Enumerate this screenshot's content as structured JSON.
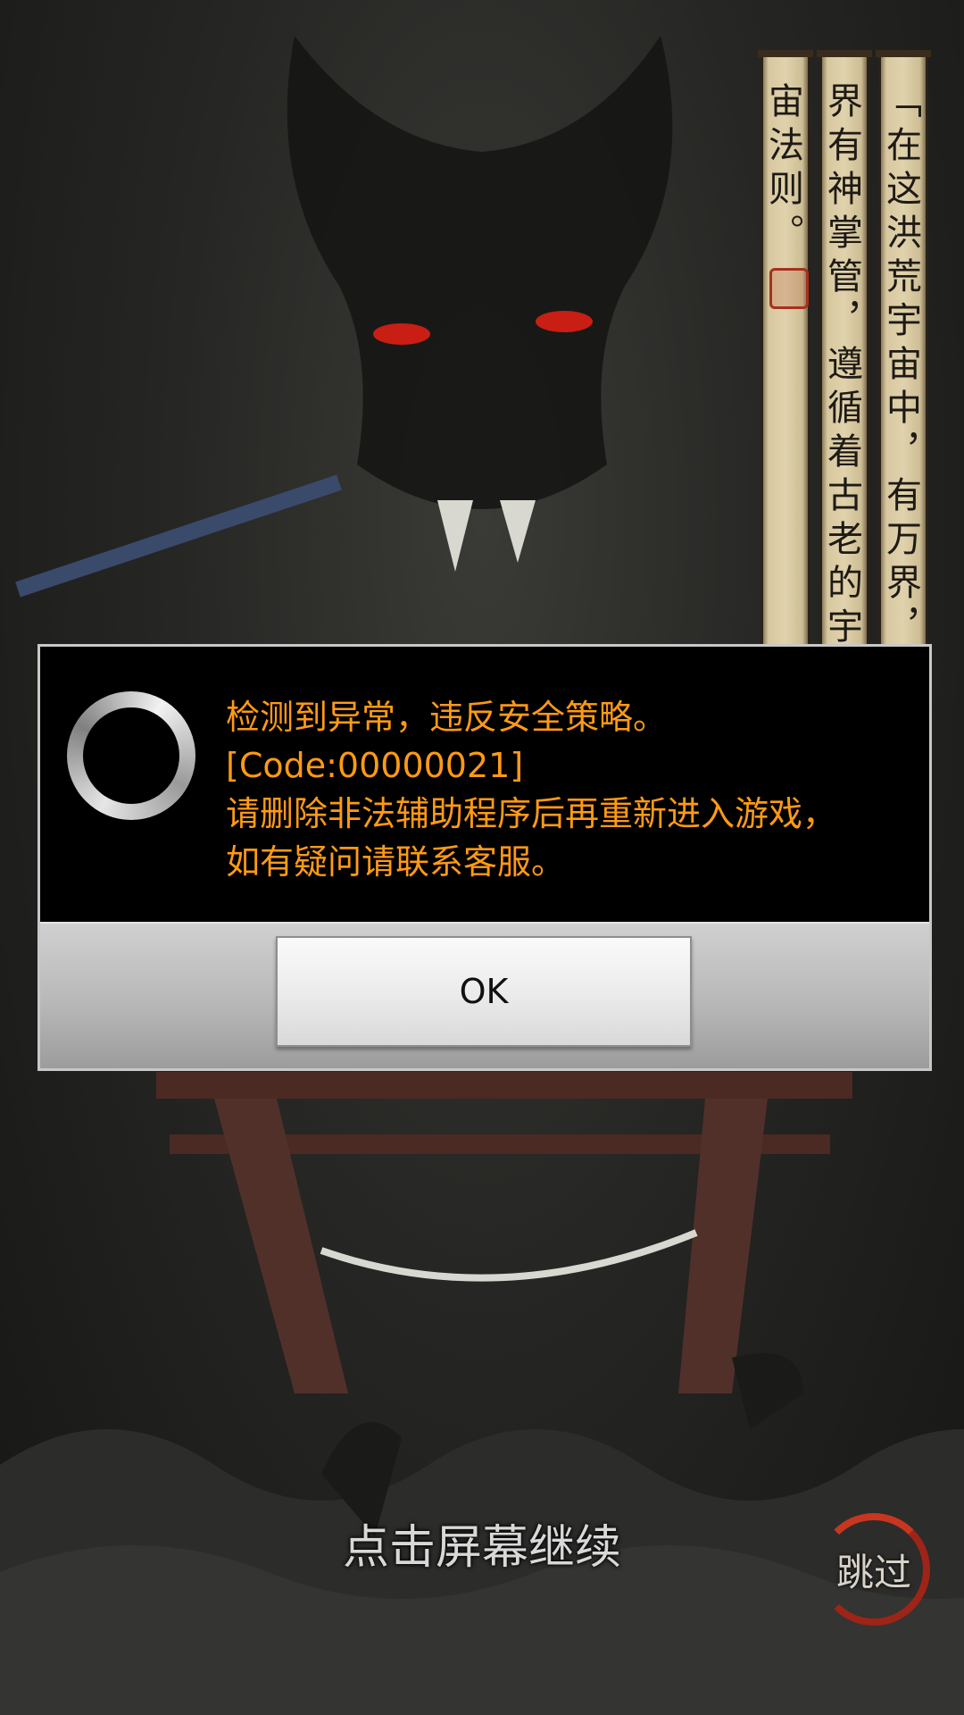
{
  "background": {
    "scrolls": [
      {
        "text": "「在这洪荒宇宙中，有万界，每"
      },
      {
        "text": "界有神掌管，遵循着古老的宇"
      },
      {
        "text": "宙法则。"
      }
    ]
  },
  "dialog": {
    "message_lines": [
      "检测到异常，违反安全策略。",
      "[Code:00000021]",
      "请删除非法辅助程序后再重新进入游戏，",
      "如有疑问请联系客服。"
    ],
    "ok_label": "OK",
    "text_color": "#ff9a14"
  },
  "footer": {
    "continue_text": "点击屏幕继续",
    "skip_label": "跳过"
  }
}
